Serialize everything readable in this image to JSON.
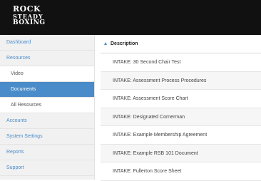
{
  "logo": {
    "line1": "ROCK",
    "line2": "STEADY",
    "line3": "BOXING"
  },
  "sidebar": {
    "items": [
      {
        "label": "Dashboard"
      },
      {
        "label": "Resources"
      },
      {
        "label": "Accounts"
      },
      {
        "label": "System Settings"
      },
      {
        "label": "Reports"
      },
      {
        "label": "Support"
      }
    ],
    "resources_sub": [
      {
        "label": "Video"
      },
      {
        "label": "Documents",
        "active": true
      },
      {
        "label": "All Resources"
      }
    ]
  },
  "table": {
    "header": "Description",
    "sort_icon": "sort-ascending-icon",
    "rows": [
      "INTAKE: 30 Second Chair Test",
      "INTAKE: Assessment Process Procedures",
      "INTAKE: Assessment Score Chart",
      "INTAKE: Designated Cornerman",
      "INTAKE: Example Membership Agreement",
      "INTAKE: Example RSB 101 Document",
      "INTAKE: Fullerton Score Sheet"
    ]
  },
  "colors": {
    "accent": "#4a8cc9",
    "topbar": "#111111",
    "sidebar_bg": "#f1f1f1"
  }
}
